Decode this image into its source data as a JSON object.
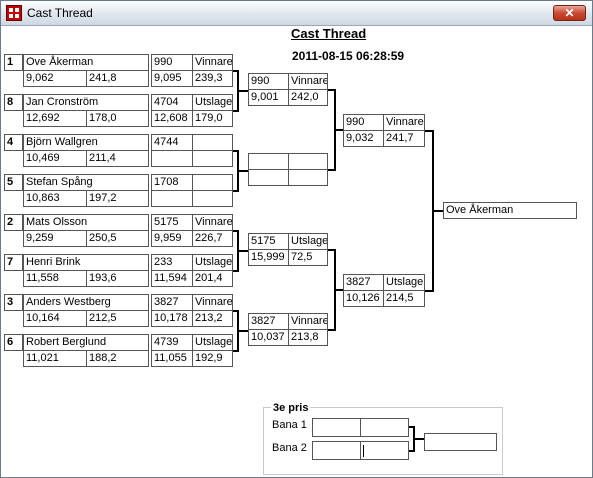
{
  "window": {
    "title": "Cast Thread",
    "close_glyph": "✕"
  },
  "header": {
    "title": "Cast Thread",
    "datetime": "2011-08-15 06:28:59"
  },
  "round1": [
    {
      "seed": "1",
      "name": "Ove Åkerman",
      "a": "9,062",
      "b": "241,8",
      "code": "990",
      "result": "Vinnare",
      "c": "9,095",
      "d": "239,3"
    },
    {
      "seed": "8",
      "name": "Jan Cronström",
      "a": "12,692",
      "b": "178,0",
      "code": "4704",
      "result": "Utslagen",
      "c": "12,608",
      "d": "179,0"
    },
    {
      "seed": "4",
      "name": "Björn Wallgren",
      "a": "10,469",
      "b": "211,4",
      "code": "4744",
      "result": "",
      "c": "",
      "d": ""
    },
    {
      "seed": "5",
      "name": "Stefan Spång",
      "a": "10,863",
      "b": "197,2",
      "code": "1708",
      "result": "",
      "c": "",
      "d": ""
    },
    {
      "seed": "2",
      "name": "Mats Olsson",
      "a": "9,259",
      "b": "250,5",
      "code": "5175",
      "result": "Vinnare",
      "c": "9,959",
      "d": "226,7"
    },
    {
      "seed": "7",
      "name": "Henri Brink",
      "a": "11,558",
      "b": "193,6",
      "code": "233",
      "result": "Utslagen",
      "c": "11,594",
      "d": "201,4"
    },
    {
      "seed": "3",
      "name": "Anders Westberg",
      "a": "10,164",
      "b": "212,5",
      "code": "3827",
      "result": "Vinnare",
      "c": "10,178",
      "d": "213,2"
    },
    {
      "seed": "6",
      "name": "Robert Berglund",
      "a": "11,021",
      "b": "188,2",
      "code": "4739",
      "result": "Utslagen",
      "c": "11,055",
      "d": "192,9"
    }
  ],
  "quarterfinals": [
    {
      "code": "990",
      "result": "Vinnare",
      "a": "9,001",
      "b": "242,0"
    },
    {
      "code": "",
      "result": "",
      "a": "",
      "b": ""
    },
    {
      "code": "5175",
      "result": "Utslagen",
      "a": "15,999",
      "b": "72,5"
    },
    {
      "code": "3827",
      "result": "Vinnare",
      "a": "10,037",
      "b": "213,8"
    }
  ],
  "semifinals": [
    {
      "code": "990",
      "result": "Vinnare",
      "a": "9,032",
      "b": "241,7"
    },
    {
      "code": "3827",
      "result": "Utslagen",
      "a": "10,126",
      "b": "214,5"
    }
  ],
  "final": {
    "winner": "Ove Åkerman"
  },
  "third_place": {
    "title": "3e pris",
    "lane1_label": "Bana 1",
    "lane2_label": "Bana 2",
    "lane1": [
      "",
      ""
    ],
    "lane2": [
      "",
      ""
    ],
    "winner": ""
  }
}
